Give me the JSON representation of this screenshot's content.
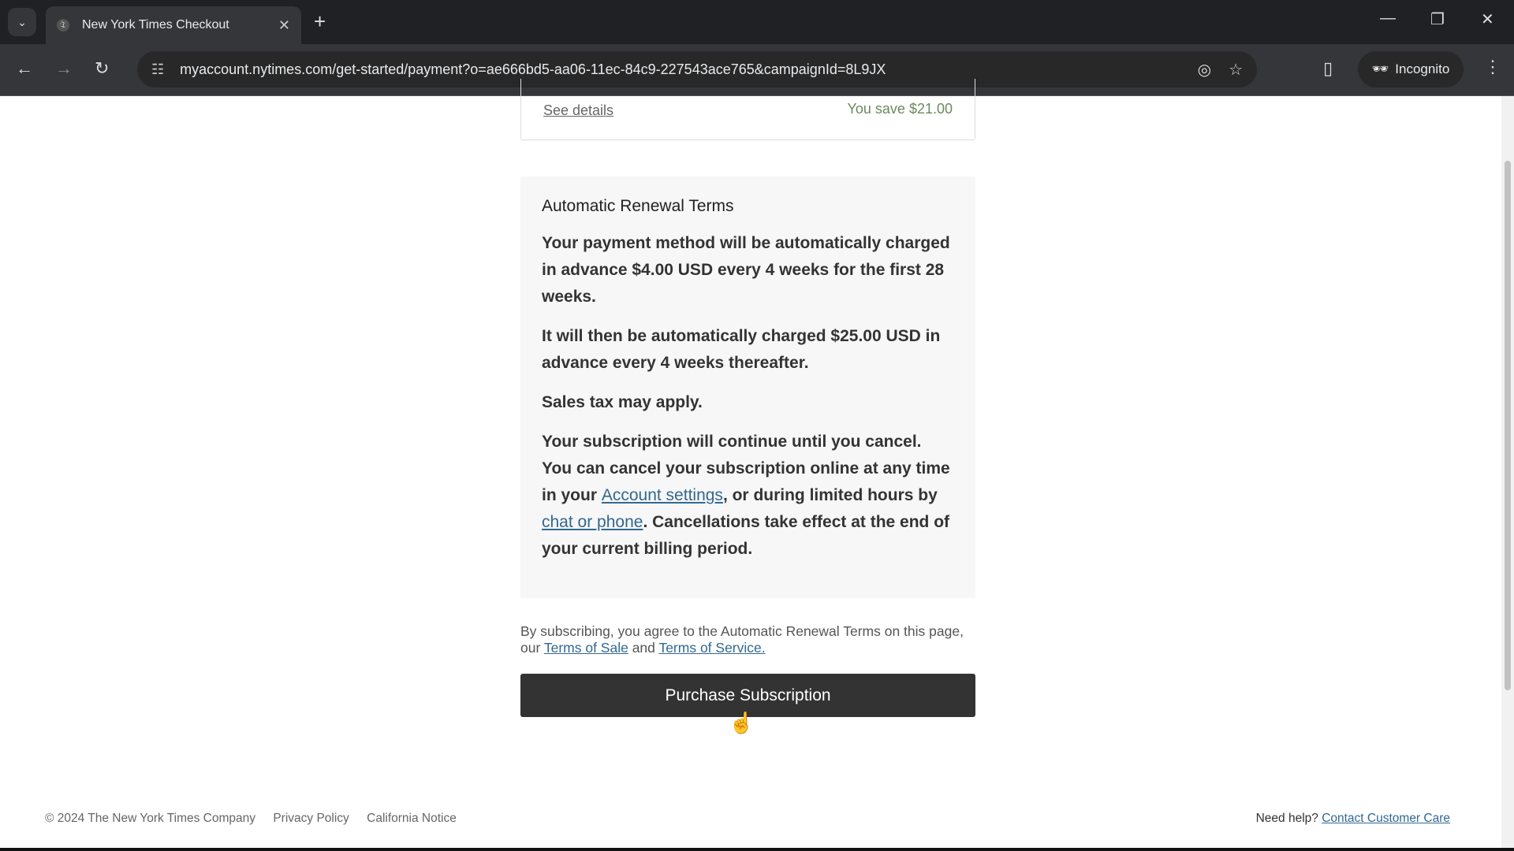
{
  "browser": {
    "tab_title": "New York Times Checkout",
    "url": "myaccount.nytimes.com/get-started/payment?o=ae666bd5-aa06-11ec-84c9-227543ace765&campaignId=8L9JX",
    "incognito_label": "Incognito"
  },
  "summary": {
    "see_details": "See details",
    "savings": "You save $21.00"
  },
  "terms": {
    "title": "Automatic Renewal Terms",
    "p1": "Your payment method will be automatically charged in advance $4.00 USD every 4 weeks for the first 28 weeks.",
    "p2": "It will then be automatically charged $25.00 USD in advance every 4 weeks thereafter.",
    "p3": "Sales tax may apply.",
    "p4a": "Your subscription will continue until you cancel. You can cancel your subscription online at any time in your ",
    "account_link": "Account settings",
    "p4b": ", or during limited hours by ",
    "chat_link": "chat or phone",
    "p4c": ". Cancellations take effect at the end of your current billing period."
  },
  "disclaimer": {
    "a": "By subscribing, you agree to the Automatic Renewal Terms on this page, our ",
    "sale_link": "Terms of Sale",
    "b": " and ",
    "service_link": "Terms of Service."
  },
  "purchase_button": "Purchase Subscription",
  "footer": {
    "copyright": "© 2024 The New York Times Company",
    "privacy": "Privacy Policy",
    "california": "California Notice",
    "help": "Need help? ",
    "contact": "Contact Customer Care"
  },
  "colors": {
    "link": "#326891",
    "button": "#333333",
    "savings": "#6b8a5e"
  }
}
